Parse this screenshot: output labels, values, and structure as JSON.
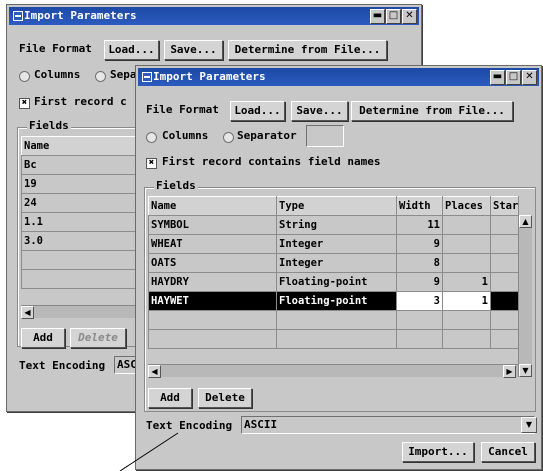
{
  "back_window": {
    "title": "Import Parameters",
    "file_format_label": "File Format",
    "load_label": "Load...",
    "save_label": "Save...",
    "determine_label": "Determine from File...",
    "columns_label": "Columns",
    "separator_label_partial": "Separ",
    "first_record_partial": "First record c",
    "fields_label": "Fields",
    "name_header": "Name",
    "rows": [
      "Bc",
      "19",
      "24",
      "1.1",
      "3.0"
    ],
    "add_label": "Add",
    "delete_label": "Delete",
    "encoding_label": "Text Encoding",
    "encoding_partial": "ASC"
  },
  "front_window": {
    "title": "Import Parameters",
    "file_format_label": "File Format",
    "load_label": "Load...",
    "save_label": "Save...",
    "determine_label": "Determine from File...",
    "columns_label": "Columns",
    "separator_label": "Separator",
    "separator_value": "",
    "first_record_label": "First record contains field names",
    "first_record_checked": true,
    "fields_label": "Fields",
    "headers": [
      "Name",
      "Type",
      "Width",
      "Places",
      "Star"
    ],
    "rows": [
      {
        "name": "SYMBOL",
        "type": "String",
        "width": "11",
        "places": ""
      },
      {
        "name": "WHEAT",
        "type": "Integer",
        "width": "9",
        "places": ""
      },
      {
        "name": "OATS",
        "type": "Integer",
        "width": "8",
        "places": ""
      },
      {
        "name": "HAYDRY",
        "type": "Floating-point",
        "width": "9",
        "places": "1"
      },
      {
        "name": "HAYWET",
        "type": "Floating-point",
        "width": "3",
        "places": "1"
      }
    ],
    "selected_row": 4,
    "add_label": "Add",
    "delete_label": "Delete",
    "encoding_label": "Text Encoding",
    "encoding_value": "ASCII",
    "import_label": "Import...",
    "cancel_label": "Cancel"
  },
  "icons": {
    "window_menu": "window-menu-icon",
    "minimize": "minimize-icon",
    "maximize": "maximize-icon",
    "close": "close-icon",
    "checkmark": "✖",
    "scroll_up": "▲",
    "scroll_down": "▼",
    "scroll_left": "◀",
    "scroll_right": "▶",
    "dropdown": "▼"
  },
  "colors": {
    "titlebar": "#1d49a6",
    "window_bg": "#c8c8c8",
    "selection": "#000000"
  }
}
